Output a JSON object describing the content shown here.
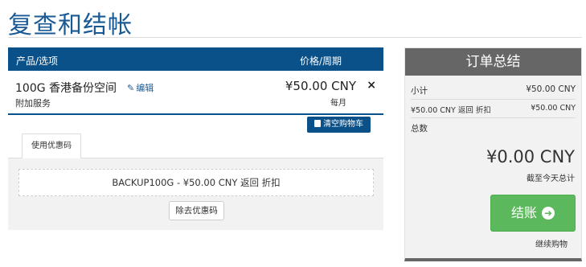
{
  "page": {
    "title": "复查和结帐"
  },
  "cart": {
    "header": {
      "product": "产品/选项",
      "price": "价格/周期"
    },
    "item": {
      "name": "100G 香港备份空间",
      "edit_label": "编辑",
      "subtitle": "附加服务",
      "price": "¥50.00 CNY",
      "cycle": "每月",
      "remove_glyph": "×"
    },
    "empty_cart_label": "清空购物车"
  },
  "promo": {
    "tab_label": "使用优惠码",
    "applied_text": "BACKUP100G - ¥50.00 CNY 返回 折扣",
    "remove_label": "除去优惠码"
  },
  "summary": {
    "title": "订单总结",
    "subtotal_label": "小计",
    "subtotal_value": "¥50.00 CNY",
    "discount_label": "¥50.00 CNY 返回 折扣",
    "discount_value": "¥50.00 CNY",
    "total_label": "总数",
    "total_amount": "¥0.00 CNY",
    "total_caption": "截至今天总计",
    "checkout_label": "结账",
    "continue_label": "继续购物"
  },
  "colors": {
    "brand_blue": "#0b5189",
    "title_blue": "#1a5a94",
    "summary_gray": "#666666",
    "checkout_green": "#5cb85c"
  },
  "icons": {
    "edit": "pencil-icon",
    "remove": "close-icon",
    "empty_cart": "trash-icon",
    "checkout": "arrow-right-circle-icon"
  }
}
